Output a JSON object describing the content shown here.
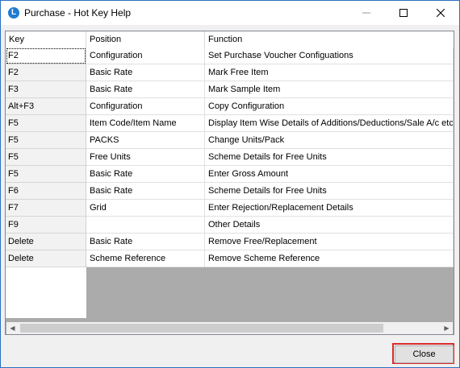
{
  "window": {
    "title": "Purchase - Hot Key Help",
    "icon": "app-logo-icon",
    "controls": [
      "minimize-icon",
      "maximize-icon",
      "close-icon"
    ]
  },
  "table": {
    "columns": [
      "Key",
      "Position",
      "Function"
    ],
    "rows": [
      {
        "key": "F2",
        "position": "Configuration",
        "function": "Set Purchase Voucher Configuations",
        "selected": true
      },
      {
        "key": "F2",
        "position": "Basic Rate",
        "function": "Mark Free Item"
      },
      {
        "key": "F3",
        "position": "Basic Rate",
        "function": "Mark Sample Item"
      },
      {
        "key": "Alt+F3",
        "position": "Configuration",
        "function": "Copy Configuration"
      },
      {
        "key": "F5",
        "position": "Item Code/Item Name",
        "function": "Display Item Wise Details of Additions/Deductions/Sale A/c etc"
      },
      {
        "key": "F5",
        "position": "PACKS",
        "function": "Change Units/Pack"
      },
      {
        "key": "F5",
        "position": "Free Units",
        "function": "Scheme Details for Free Units"
      },
      {
        "key": "F5",
        "position": "Basic Rate",
        "function": "Enter Gross Amount"
      },
      {
        "key": "F6",
        "position": "Basic Rate",
        "function": "Scheme Details for Free Units"
      },
      {
        "key": "F7",
        "position": "Grid",
        "function": "Enter Rejection/Replacement Details"
      },
      {
        "key": "F9",
        "position": "",
        "function": "Other Details"
      },
      {
        "key": "Delete",
        "position": "Basic Rate",
        "function": "Remove Free/Replacement"
      },
      {
        "key": "Delete",
        "position": "Scheme Reference",
        "function": "Remove Scheme Reference"
      }
    ]
  },
  "footer": {
    "close_label": "Close",
    "highlight_color": "#d92b2b"
  }
}
